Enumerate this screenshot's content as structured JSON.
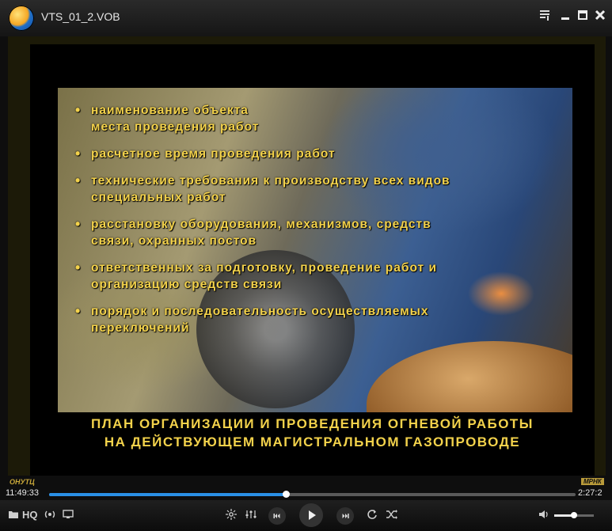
{
  "window": {
    "title": "VTS_01_2.VOB"
  },
  "video": {
    "bullets": [
      "наименование объекта\nместа проведения работ",
      "расчетное время проведения работ",
      "технические требования к производству всех видов\nспециальных работ",
      "расстановку оборудования, механизмов, средств\nсвязи, охранных постов",
      "ответственных за подготовку, проведение работ и\nорганизацию средств связи",
      "порядок и последовательность осуществляемых\nпереключений"
    ],
    "caption": "ПЛАН ОРГАНИЗАЦИИ И ПРОВЕДЕНИЯ ОГНЕВОЙ РАБОТЫ\nНА ДЕЙСТВУЮЩЕМ МАГИСТРАЛЬНОМ ГАЗОПРОВОДЕ",
    "logo_left": "ОНУТЦ",
    "logo_right": "МРНК"
  },
  "playback": {
    "current_time": "11:49:33",
    "total_time": "2:27:2",
    "progress": 0.45,
    "volume": 0.5
  },
  "controls": {
    "folder_icon": "folder-icon",
    "hq_label": "HQ",
    "broadcast_icon": "broadcast-icon",
    "subtitle_icon": "subtitle-icon",
    "settings_icon": "settings-icon",
    "equalizer_icon": "equalizer-icon",
    "prev_icon": "prev-icon",
    "play_icon": "play-icon",
    "next_icon": "next-icon",
    "repeat_icon": "repeat-icon",
    "shuffle_icon": "shuffle-icon",
    "volume_icon": "volume-icon"
  },
  "colors": {
    "accent": "#2a8fe6",
    "text_overlay": "#f3d24b"
  }
}
